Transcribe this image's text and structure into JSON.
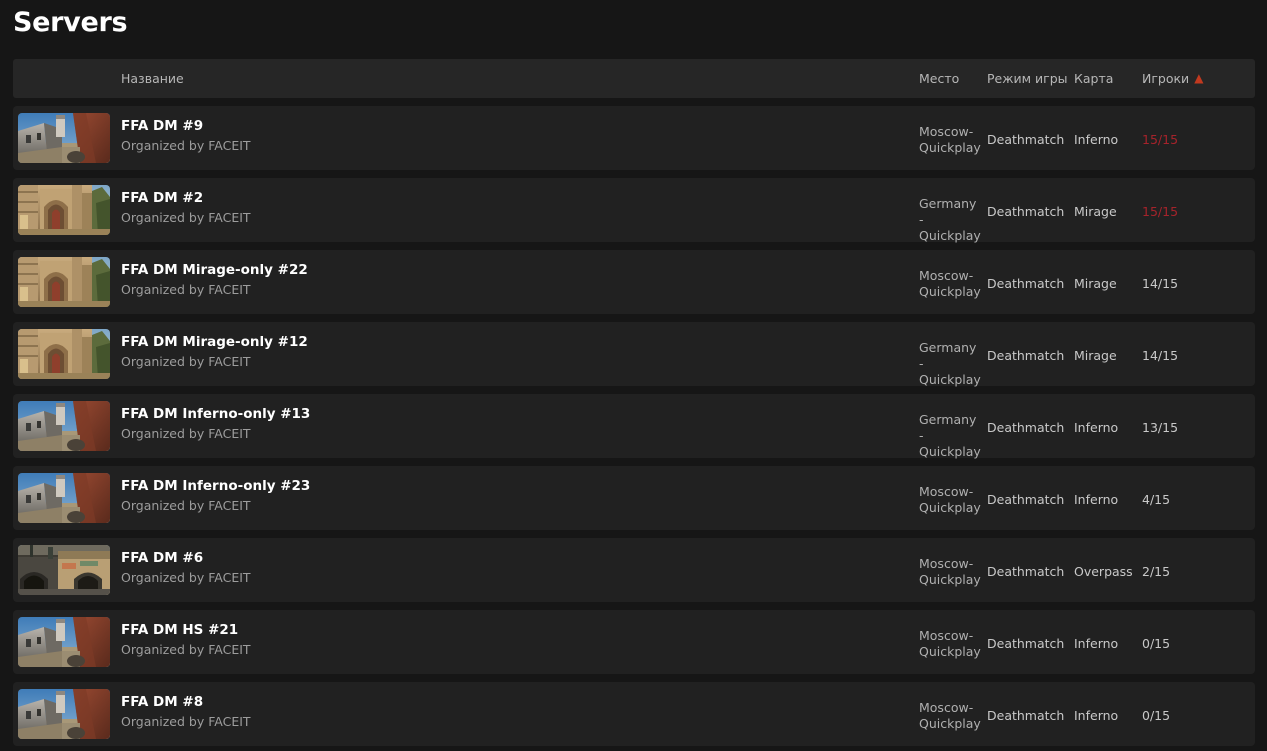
{
  "page": {
    "title": "Servers"
  },
  "table": {
    "columns": {
      "name": "Название",
      "place": "Место",
      "mode": "Режим игры",
      "map": "Карта",
      "players": "Игроки"
    },
    "sort": {
      "column": "players",
      "direction": "asc",
      "arrow_glyph": "▲",
      "arrow_color": "#c1391f"
    },
    "rows": [
      {
        "name": "FFA DM #9",
        "organizer": "Organized by FACEIT",
        "place": "Moscow-Quickplay",
        "mode": "Deathmatch",
        "map": "Inferno",
        "players": "15/15",
        "full": true,
        "thumb": "inferno"
      },
      {
        "name": "FFA DM #2",
        "organizer": "Organized by FACEIT",
        "place": "Germany-Quickplay",
        "mode": "Deathmatch",
        "map": "Mirage",
        "players": "15/15",
        "full": true,
        "thumb": "mirage"
      },
      {
        "name": "FFA DM Mirage-only #22",
        "organizer": "Organized by FACEIT",
        "place": "Moscow-Quickplay",
        "mode": "Deathmatch",
        "map": "Mirage",
        "players": "14/15",
        "full": false,
        "thumb": "mirage"
      },
      {
        "name": "FFA DM Mirage-only #12",
        "organizer": "Organized by FACEIT",
        "place": "Germany-Quickplay",
        "mode": "Deathmatch",
        "map": "Mirage",
        "players": "14/15",
        "full": false,
        "thumb": "mirage"
      },
      {
        "name": "FFA DM Inferno-only #13",
        "organizer": "Organized by FACEIT",
        "place": "Germany-Quickplay",
        "mode": "Deathmatch",
        "map": "Inferno",
        "players": "13/15",
        "full": false,
        "thumb": "inferno"
      },
      {
        "name": "FFA DM Inferno-only #23",
        "organizer": "Organized by FACEIT",
        "place": "Moscow-Quickplay",
        "mode": "Deathmatch",
        "map": "Inferno",
        "players": "4/15",
        "full": false,
        "thumb": "inferno"
      },
      {
        "name": "FFA DM #6",
        "organizer": "Organized by FACEIT",
        "place": "Moscow-Quickplay",
        "mode": "Deathmatch",
        "map": "Overpass",
        "players": "2/15",
        "full": false,
        "thumb": "overpass"
      },
      {
        "name": "FFA DM HS #21",
        "organizer": "Organized by FACEIT",
        "place": "Moscow-Quickplay",
        "mode": "Deathmatch",
        "map": "Inferno",
        "players": "0/15",
        "full": false,
        "thumb": "inferno"
      },
      {
        "name": "FFA DM #8",
        "organizer": "Organized by FACEIT",
        "place": "Moscow-Quickplay",
        "mode": "Deathmatch",
        "map": "Inferno",
        "players": "0/15",
        "full": false,
        "thumb": "inferno"
      }
    ]
  },
  "colors": {
    "background": "#161616",
    "row": "#212121",
    "header": "#262626",
    "accent": "#c1391f",
    "full_players": "#a5232b"
  }
}
